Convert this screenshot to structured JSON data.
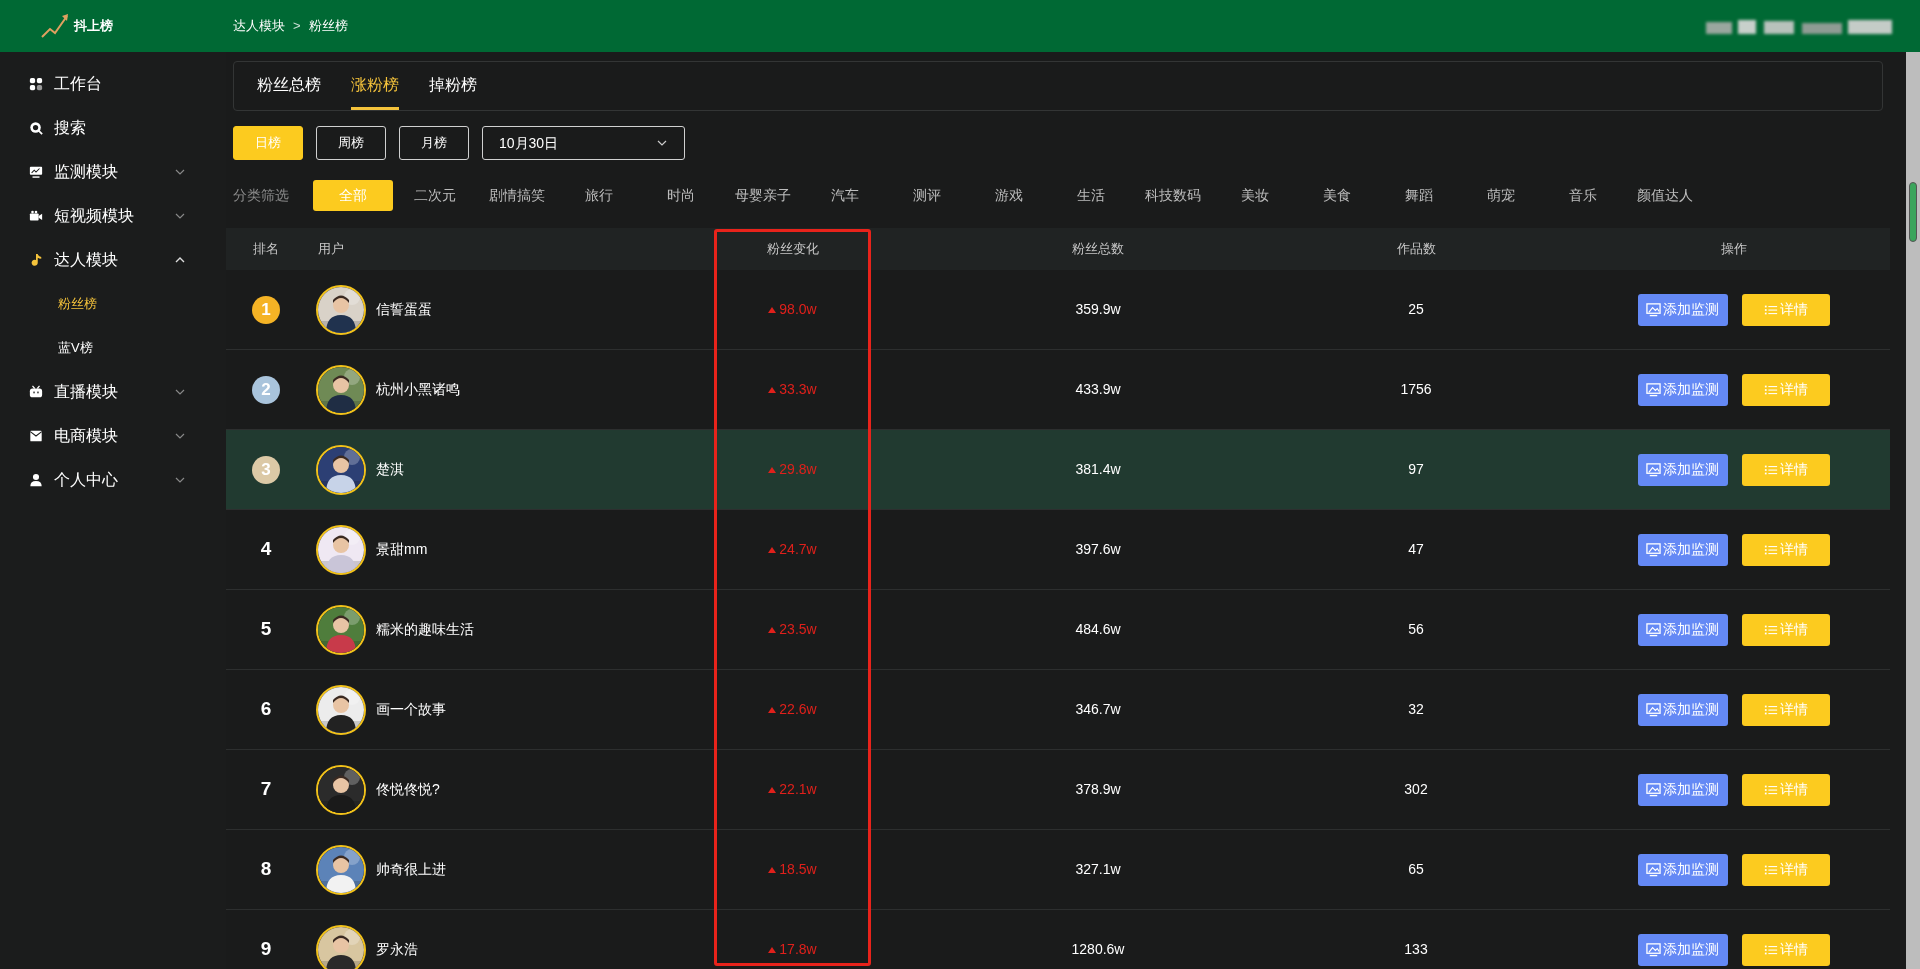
{
  "logo": {
    "text": "抖上榜"
  },
  "breadcrumb": {
    "items": [
      "达人模块",
      "粉丝榜"
    ],
    "separator": ">"
  },
  "sidebar": {
    "items": [
      {
        "label": "工作台",
        "kind": "link"
      },
      {
        "label": "搜索",
        "kind": "link"
      },
      {
        "label": "监测模块",
        "kind": "group",
        "expanded": false
      },
      {
        "label": "短视频模块",
        "kind": "group",
        "expanded": false
      },
      {
        "label": "达人模块",
        "kind": "group",
        "expanded": true,
        "children": [
          {
            "label": "粉丝榜",
            "selected": true
          },
          {
            "label": "蓝V榜",
            "selected": false
          }
        ]
      },
      {
        "label": "直播模块",
        "kind": "group",
        "expanded": false
      },
      {
        "label": "电商模块",
        "kind": "group",
        "expanded": false
      },
      {
        "label": "个人中心",
        "kind": "group",
        "expanded": false
      }
    ]
  },
  "tabs": [
    {
      "label": "粉丝总榜",
      "selected": false
    },
    {
      "label": "涨粉榜",
      "selected": true
    },
    {
      "label": "掉粉榜",
      "selected": false
    }
  ],
  "period_buttons": [
    {
      "label": "日榜",
      "selected": true
    },
    {
      "label": "周榜",
      "selected": false
    },
    {
      "label": "月榜",
      "selected": false
    }
  ],
  "date_select": {
    "value": "10月30日"
  },
  "category_filter": {
    "label": "分类筛选",
    "options": [
      {
        "label": "全部",
        "selected": true
      },
      {
        "label": "二次元",
        "selected": false
      },
      {
        "label": "剧情搞笑",
        "selected": false
      },
      {
        "label": "旅行",
        "selected": false
      },
      {
        "label": "时尚",
        "selected": false
      },
      {
        "label": "母婴亲子",
        "selected": false
      },
      {
        "label": "汽车",
        "selected": false
      },
      {
        "label": "测评",
        "selected": false
      },
      {
        "label": "游戏",
        "selected": false
      },
      {
        "label": "生活",
        "selected": false
      },
      {
        "label": "科技数码",
        "selected": false
      },
      {
        "label": "美妆",
        "selected": false
      },
      {
        "label": "美食",
        "selected": false
      },
      {
        "label": "舞蹈",
        "selected": false
      },
      {
        "label": "萌宠",
        "selected": false
      },
      {
        "label": "音乐",
        "selected": false
      },
      {
        "label": "颜值达人",
        "selected": false
      }
    ]
  },
  "table": {
    "columns": [
      {
        "label": "排名",
        "highlighted": false
      },
      {
        "label": "用户",
        "highlighted": false
      },
      {
        "label": "粉丝变化",
        "highlighted": true
      },
      {
        "label": "粉丝总数",
        "highlighted": false
      },
      {
        "label": "作品数",
        "highlighted": false
      },
      {
        "label": "操作",
        "highlighted": false
      }
    ],
    "rows": [
      {
        "rank": "1",
        "color": "#f5b325",
        "user": "信誓蛋蛋",
        "fans_change": "98.0w",
        "fans_total": "359.9w",
        "works": "25",
        "highlighted": false,
        "actions": [
          "添加监测",
          "详情"
        ]
      },
      {
        "rank": "2",
        "color": "#a9c4dc",
        "user": "杭州小黑诸鸣",
        "fans_change": "33.3w",
        "fans_total": "433.9w",
        "works": "1756",
        "highlighted": false,
        "actions": [
          "添加监测",
          "详情"
        ]
      },
      {
        "rank": "3",
        "color": "#dcc9a6",
        "user": "楚淇",
        "fans_change": "29.8w",
        "fans_total": "381.4w",
        "works": "97",
        "highlighted": true,
        "actions": [
          "添加监测",
          "详情"
        ]
      },
      {
        "rank": "4",
        "user": "景甜mm",
        "fans_change": "24.7w",
        "fans_total": "397.6w",
        "works": "47",
        "highlighted": false,
        "actions": [
          "添加监测",
          "详情"
        ]
      },
      {
        "rank": "5",
        "user": "糯米的趣味生活",
        "fans_change": "23.5w",
        "fans_total": "484.6w",
        "works": "56",
        "highlighted": false,
        "actions": [
          "添加监测",
          "详情"
        ]
      },
      {
        "rank": "6",
        "user": "画一个故事",
        "fans_change": "22.6w",
        "fans_total": "346.7w",
        "works": "32",
        "highlighted": false,
        "actions": [
          "添加监测",
          "详情"
        ]
      },
      {
        "rank": "7",
        "user": "佟悦佟悦?",
        "fans_change": "22.1w",
        "fans_total": "378.9w",
        "works": "302",
        "highlighted": false,
        "actions": [
          "添加监测",
          "详情"
        ]
      },
      {
        "rank": "8",
        "user": "帅奇很上进",
        "fans_change": "18.5w",
        "fans_total": "327.1w",
        "works": "65",
        "highlighted": false,
        "actions": [
          "添加监测",
          "详情"
        ]
      },
      {
        "rank": "9",
        "user": "罗永浩",
        "fans_change": "17.8w",
        "fans_total": "1280.6w",
        "works": "133",
        "highlighted": false,
        "actions": [
          "添加监测",
          "详情"
        ]
      }
    ]
  }
}
